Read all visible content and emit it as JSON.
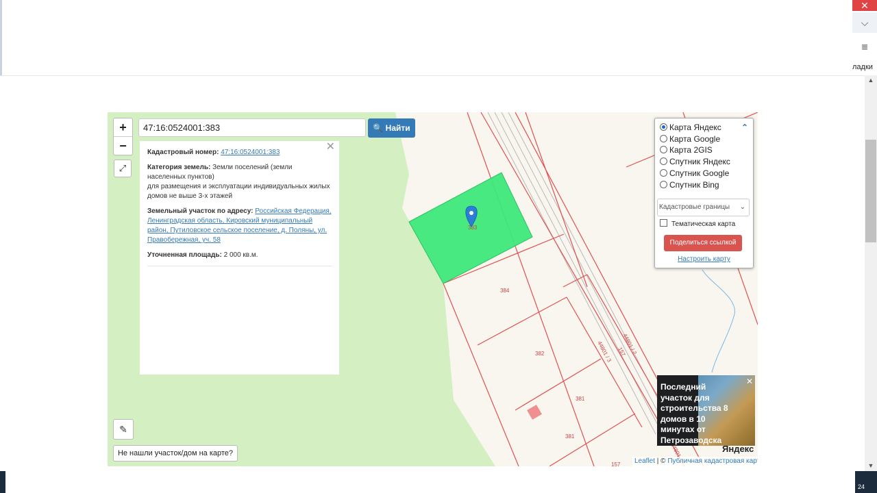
{
  "browser": {
    "close_glyph": "✕",
    "chevron_glyph": "⌵",
    "menu_glyph": "≡",
    "bookmarks_label": "ладки",
    "tray_number": "24"
  },
  "map": {
    "zoom_in": "+",
    "zoom_out": "−",
    "fullscreen_glyph": "⤢",
    "search": {
      "value": "47:16:0524001:383",
      "button_label": "Найти"
    },
    "parcel_labels": {
      "p383": "383",
      "p384": "384",
      "p382": "382",
      "p381a": "381",
      "p381b": "381",
      "road1": "44801 / 3",
      "road2": "157",
      "road3": "44801 / 2",
      "road4": "44801",
      "road5": "157"
    },
    "info": {
      "cadastral_label": "Кадастровый номер:",
      "cadastral_value": "47:16:0524001:383",
      "category_label": "Категория земель:",
      "category_value": "Земли поселений (земли населенных пунктов)",
      "usage_value": "для размещения и эксплуатации индивидуальных жилых домов не выше 3-х этажей",
      "address_label": "Земельный участок по адресу:",
      "address_value": "Российская Федерация, Ленинградская область, Кировский муниципальный район, Путиловское сельское поселение, д. Поляны, ул. Правобережная, уч. 58",
      "area_label": "Уточненная площадь:",
      "area_value": "2 000 кв.м.",
      "close_glyph": "✕"
    },
    "ruler_glyph": "✎",
    "not_found_button": "Не нашли участок/дом на карте?",
    "layers": {
      "options": [
        {
          "label": "Карта Яндекс",
          "selected": true
        },
        {
          "label": "Карта Google",
          "selected": false
        },
        {
          "label": "Карта 2GIS",
          "selected": false
        },
        {
          "label": "Спутник Яндекс",
          "selected": false
        },
        {
          "label": "Спутник Google",
          "selected": false
        },
        {
          "label": "Спутник Bing",
          "selected": false
        }
      ],
      "collapse_glyph": "⌃",
      "select_value": "Кадастровые границы",
      "select_chevron": "⌄",
      "thematic_label": "Тематическая карта",
      "share_button": "Поделиться ссылкой",
      "configure_link": "Настроить карту"
    },
    "ad": {
      "text": "Последний участок для строительства 8 домов в 10 минутах от Петрозаводска",
      "close_glyph": "✕"
    },
    "yandex_logo": "Яндекс",
    "attribution": {
      "leaflet": "Leaflet",
      "separator": " | © ",
      "cadastral": "Публичная кадастровая карта"
    },
    "colors": {
      "meadow": "#d4f0c2",
      "land": "#f8f6ef",
      "parcel_line": "#e05050",
      "selected_parcel": "#3ee87a",
      "marker": "#2a7fd4",
      "search_button": "#337ab7",
      "share_button": "#d9534f"
    }
  }
}
